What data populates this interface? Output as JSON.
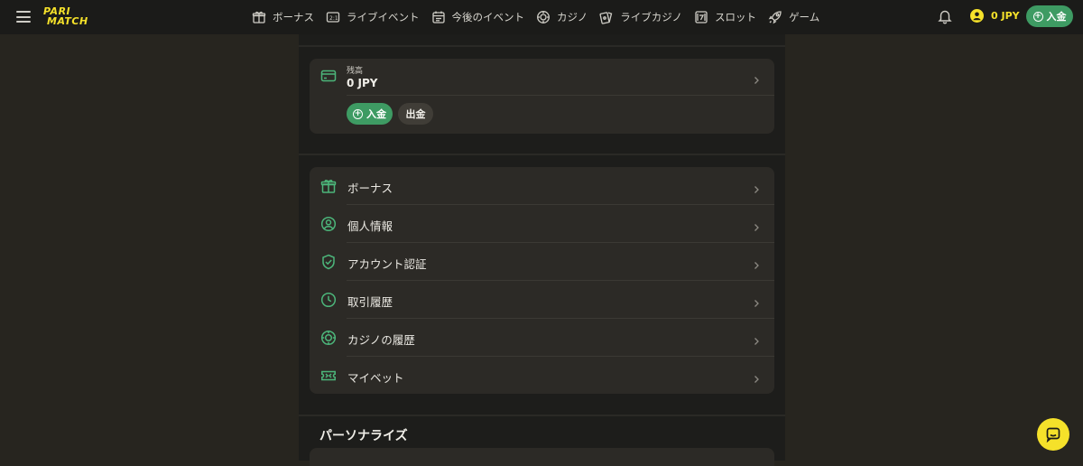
{
  "header": {
    "logo_line1": "PARI",
    "logo_line2": "MATCH",
    "nav": [
      {
        "label": "ボーナス",
        "icon": "gift-icon"
      },
      {
        "label": "ライブイベント",
        "icon": "scoreboard-icon"
      },
      {
        "label": "今後のイベント",
        "icon": "calendar-icon"
      },
      {
        "label": "カジノ",
        "icon": "casino-chip-icon"
      },
      {
        "label": "ライブカジノ",
        "icon": "cards-icon"
      },
      {
        "label": "スロット",
        "icon": "slot-icon"
      },
      {
        "label": "ゲーム",
        "icon": "rocket-icon"
      }
    ],
    "balance": "0 JPY",
    "deposit_label": "入金"
  },
  "balance_card": {
    "label": "残高",
    "value": "0 JPY",
    "deposit_label": "入金",
    "withdraw_label": "出金"
  },
  "menu": [
    {
      "label": "ボーナス",
      "icon": "gift-icon"
    },
    {
      "label": "個人情報",
      "icon": "user-circle-icon"
    },
    {
      "label": "アカウント認証",
      "icon": "shield-check-icon"
    },
    {
      "label": "取引履歴",
      "icon": "clock-icon"
    },
    {
      "label": "カジノの履歴",
      "icon": "casino-chip-icon"
    },
    {
      "label": "マイベット",
      "icon": "ticket-icon"
    }
  ],
  "section_title": "パーソナライズ",
  "colors": {
    "accent_green": "#3e9b63",
    "brand_yellow": "#f5e12a",
    "background": "#27251f",
    "panel": "#1d1d1b",
    "card": "#2c2a26"
  }
}
